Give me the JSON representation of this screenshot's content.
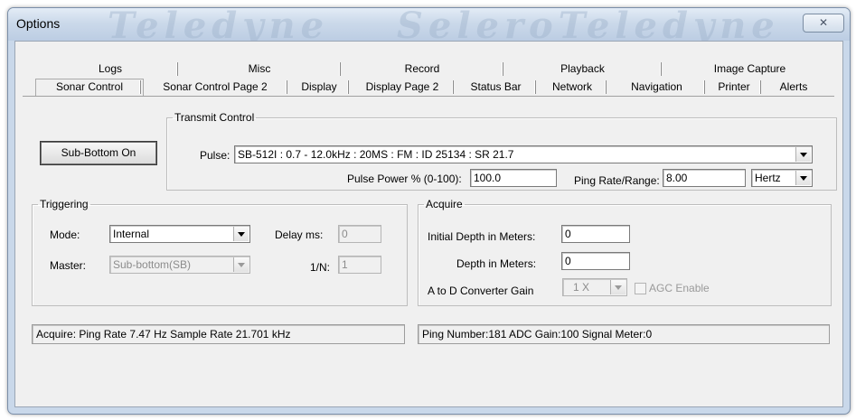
{
  "window": {
    "title": "Options",
    "close_glyph": "✕",
    "watermark_left": "Teledyne",
    "watermark_right": "SeleroTeledyne"
  },
  "tabs": {
    "row1": [
      "Logs",
      "Misc",
      "Record",
      "Playback",
      "Image Capture"
    ],
    "row2": [
      "Sonar Control",
      "Sonar Control Page 2",
      "Display",
      "Display Page 2",
      "Status Bar",
      "Network",
      "Navigation",
      "Printer",
      "Alerts"
    ],
    "active": "Sonar Control"
  },
  "transmit": {
    "legend": "Transmit Control",
    "sub_bottom_button": "Sub-Bottom On",
    "pulse_label": "Pulse:",
    "pulse_value": "SB-512I :  0.7 - 12.0kHz : 20MS : FM : ID 25134 : SR 21.7",
    "pulse_power_label": "Pulse Power % (0-100):",
    "pulse_power_value": "100.0",
    "ping_rate_label": "Ping Rate/Range:",
    "ping_rate_value": "8.00",
    "ping_rate_unit": "Hertz"
  },
  "triggering": {
    "legend": "Triggering",
    "mode_label": "Mode:",
    "mode_value": "Internal",
    "master_label": "Master:",
    "master_value": "Sub-bottom(SB)",
    "delay_label": "Delay ms:",
    "delay_value": "0",
    "n_label": "1/N:",
    "n_value": "1"
  },
  "acquire": {
    "legend": "Acquire",
    "initial_depth_label": "Initial Depth in Meters:",
    "initial_depth_value": "0",
    "depth_label": "Depth in Meters:",
    "depth_value": "0",
    "adc_gain_label": "A to D Converter Gain",
    "adc_gain_value": "1 X",
    "agc_label": "AGC Enable"
  },
  "status": {
    "left": "Acquire:  Ping Rate    7.47 Hz  Sample Rate  21.701 kHz",
    "right": "Ping Number:181   ADC Gain:100   Signal Meter:0"
  },
  "colors": {
    "frame": "#c9d8ea",
    "client": "#f0f0f0",
    "disabled_text": "#8c8c8c"
  }
}
